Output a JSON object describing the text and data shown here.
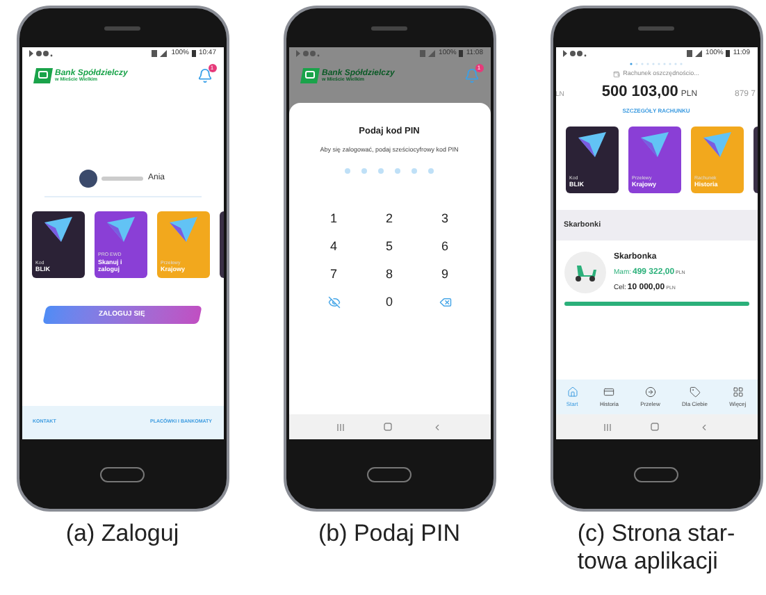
{
  "figures": [
    {
      "kind": "login",
      "caption": [
        "(a) Zaloguj"
      ],
      "status": {
        "battery": "100%",
        "time": "10:47"
      },
      "bank_name": "Bank Spółdzielczy",
      "bank_sub": "w Mieście Wielkim",
      "notification_count": "1",
      "user_name": "Ania",
      "tiles": [
        {
          "label": "Kod",
          "title": "BLIK",
          "color": "#2b2236"
        },
        {
          "label": "PRO EWD",
          "title": "Skanuj i zaloguj",
          "color": "#8a3fd6"
        },
        {
          "label": "Przelewy",
          "title": "Krajowy",
          "color": "#f2a81d"
        }
      ],
      "login_button": "ZALOGUJ SIĘ",
      "footer_links": [
        "KONTAKT",
        "PLACÓWKI I BANKOMATY"
      ]
    },
    {
      "kind": "pin",
      "caption": [
        "(b) Podaj PIN"
      ],
      "status": {
        "battery": "100%",
        "time": "11:08"
      },
      "bank_name": "Bank Spółdzielczy",
      "bank_sub": "w Mieście Wielkim",
      "notification_count": "1",
      "title": "Podaj kod PIN",
      "subtitle": "Aby się zalogować, podaj sześciocyfrowy kod PIN",
      "keys": [
        {
          "kind": "digit",
          "label": "1"
        },
        {
          "kind": "digit",
          "label": "2"
        },
        {
          "kind": "digit",
          "label": "3"
        },
        {
          "kind": "digit",
          "label": "4"
        },
        {
          "kind": "digit",
          "label": "5"
        },
        {
          "kind": "digit",
          "label": "6"
        },
        {
          "kind": "digit",
          "label": "7"
        },
        {
          "kind": "digit",
          "label": "8"
        },
        {
          "kind": "digit",
          "label": "9"
        },
        {
          "kind": "eye"
        },
        {
          "kind": "digit",
          "label": "0"
        },
        {
          "kind": "backspace"
        }
      ]
    },
    {
      "kind": "home",
      "caption": [
        "(c) Strona star-",
        "towa aplikacji"
      ],
      "status": {
        "battery": "100%",
        "time": "11:09"
      },
      "account": {
        "name": "Rachunek oszczędnościo...",
        "amount": "500 103,00",
        "currency": "PLN",
        "prev_amount": "LN",
        "next_amount": "879 7",
        "details_link": "SZCZEGÓŁY RACHUNKU"
      },
      "tiles": [
        {
          "label": "Kod",
          "title": "BLIK",
          "color": "#2b2236"
        },
        {
          "label": "Przelewy",
          "title": "Krajowy",
          "color": "#8a3fd6"
        },
        {
          "label": "Rachunek",
          "title": "Historia",
          "color": "#f2a81d"
        }
      ],
      "section_title": "Skarbonki",
      "piggy": {
        "name": "Skarbonka",
        "have_label": "Mam:",
        "have_amount": "499 322,00",
        "have_currency": "PLN",
        "goal_label": "Cel:",
        "goal_amount": "10 000,00",
        "goal_currency": "PLN",
        "level": 1
      },
      "nav": [
        {
          "label": "Start",
          "selected": true
        },
        {
          "label": "Historia",
          "selected": false
        },
        {
          "label": "Przelew",
          "selected": false
        },
        {
          "label": "Dla Ciebie",
          "selected": false
        },
        {
          "label": "Więcej",
          "selected": false
        }
      ]
    }
  ]
}
